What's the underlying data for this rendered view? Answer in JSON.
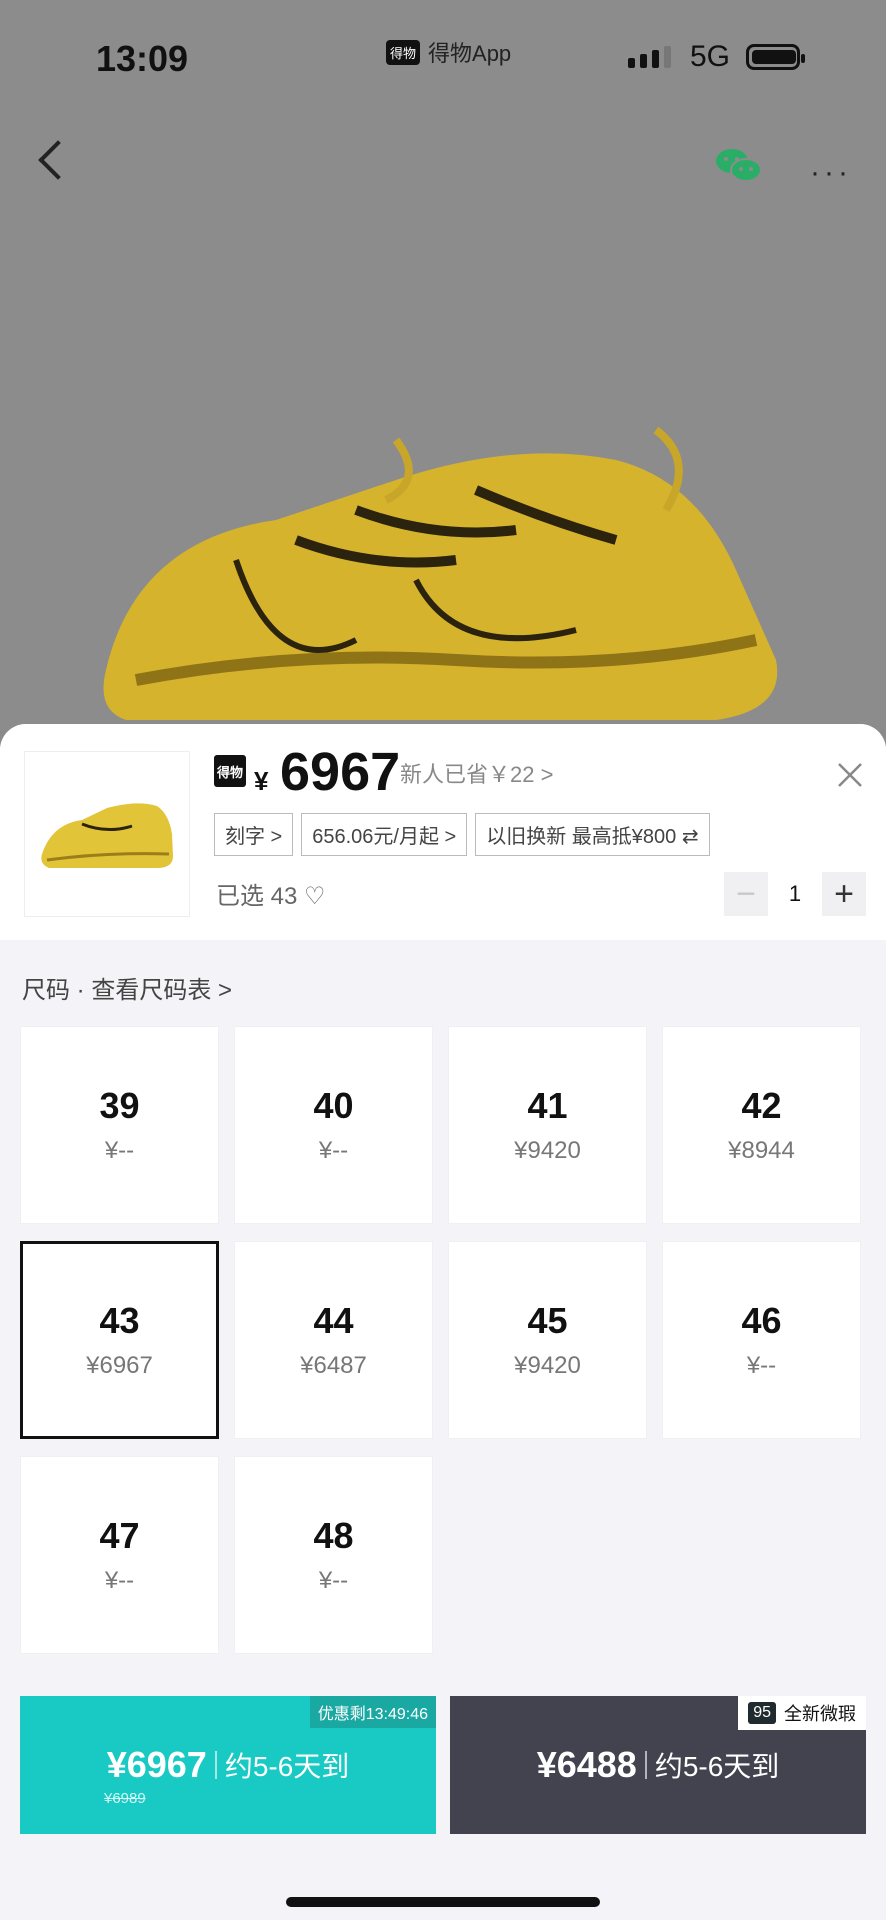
{
  "status": {
    "time": "13:09",
    "app_title": "得物App",
    "app_chip": "得物",
    "network": "5G"
  },
  "product": {
    "logo_text": "得物",
    "currency_symbol": "¥",
    "price": "6967",
    "savings": "新人已省￥22 >",
    "tags": [
      "刻字 >",
      "656.06元/月起 >",
      "以旧换新 最高抵¥800 ⇄"
    ],
    "selected": "已选 43 ♡",
    "quantity": "1"
  },
  "size_section": {
    "header": "尺码 · 查看尺码表 >"
  },
  "sizes": [
    {
      "size": "39",
      "price": "¥--"
    },
    {
      "size": "40",
      "price": "¥--"
    },
    {
      "size": "41",
      "price": "¥9420"
    },
    {
      "size": "42",
      "price": "¥8944"
    },
    {
      "size": "43",
      "price": "¥6967"
    },
    {
      "size": "44",
      "price": "¥6487"
    },
    {
      "size": "45",
      "price": "¥9420"
    },
    {
      "size": "46",
      "price": "¥--"
    },
    {
      "size": "47",
      "price": "¥--"
    },
    {
      "size": "48",
      "price": "¥--"
    }
  ],
  "buy": {
    "left_price": "¥6967",
    "left_delivery": "约5-6天到",
    "left_old_price": "¥6989",
    "left_promo": "优惠剩13:49:46",
    "right_price": "¥6488",
    "right_delivery": "约5-6天到",
    "right_badge_num": "95",
    "right_badge_text": "全新微瑕"
  },
  "colors": {
    "accent": "#19c9c3",
    "dark_button": "#434350"
  }
}
